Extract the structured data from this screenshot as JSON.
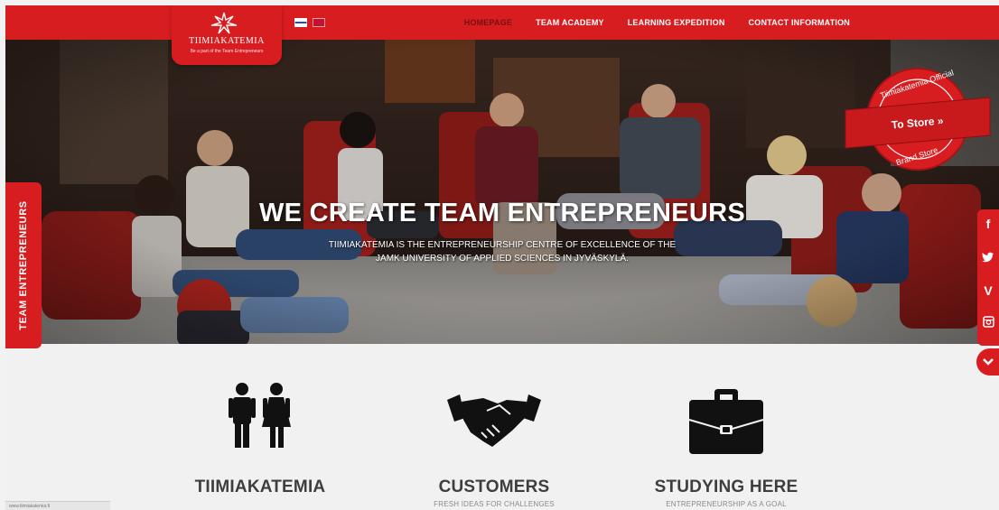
{
  "brand": {
    "name": "TIIMIAKATEMIA",
    "tagline": "Be a part of the Team Entrepreneurs"
  },
  "nav": {
    "languages": [
      "fi-flag",
      "en-flag"
    ],
    "items": [
      {
        "label": "HOMEPAGE",
        "active": true
      },
      {
        "label": "TEAM ACADEMY",
        "active": false
      },
      {
        "label": "LEARNING EXPEDITION",
        "active": false
      },
      {
        "label": "CONTACT INFORMATION",
        "active": false
      }
    ]
  },
  "hero": {
    "headline": "WE CREATE TEAM ENTREPRENEURS",
    "sub_line1": "TIIMIAKATEMIA IS THE ENTREPRENEURSHIP CENTRE OF EXCELLENCE OF THE",
    "sub_line2": "JAMK UNIVERSITY OF APPLIED SCIENCES IN JYVÄSKYLÄ."
  },
  "side_tab": {
    "label": "TEAM ENTREPRENEURS"
  },
  "badge": {
    "line1": "Tiimiakatemia Official",
    "line2": "To Store »",
    "line3": "Brand Store"
  },
  "social": {
    "items": [
      "f",
      "t",
      "V",
      "ig"
    ]
  },
  "features": [
    {
      "title": "TIIMIAKATEMIA",
      "caption": ""
    },
    {
      "title": "CUSTOMERS",
      "caption": "FRESH IDEAS FOR CHALLENGES"
    },
    {
      "title": "STUDYING HERE",
      "caption": "ENTREPRENEURSHIP AS A GOAL"
    }
  ],
  "status": {
    "text": "www.tiimiakatemia.fi"
  },
  "colors": {
    "brand_red": "#d71d20",
    "text_dark": "#3e3e3e"
  }
}
